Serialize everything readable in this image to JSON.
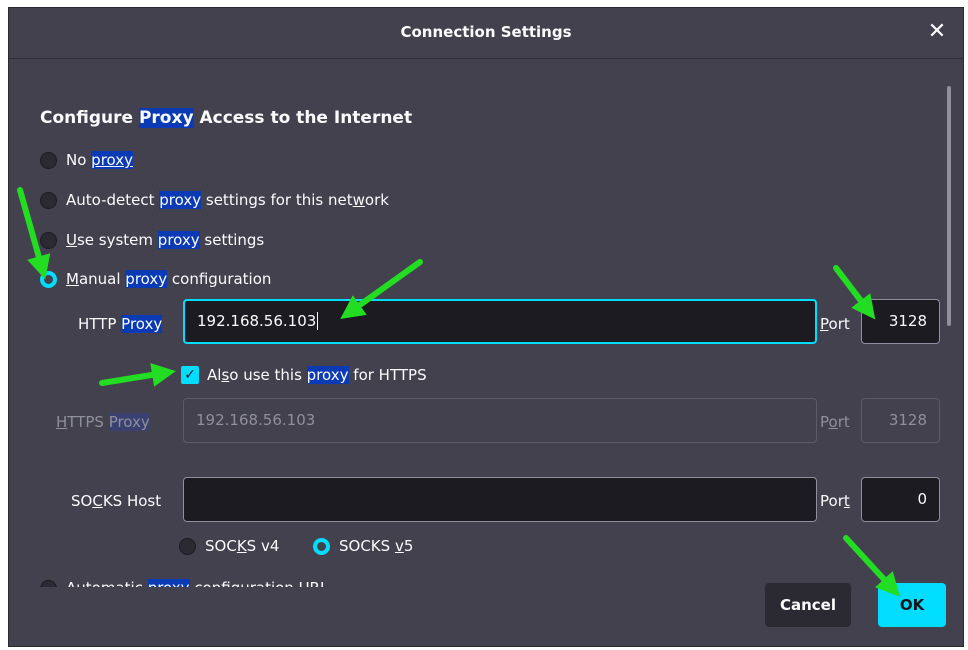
{
  "dialog": {
    "title": "Connection Settings",
    "close_icon": "✕"
  },
  "section": {
    "heading_pre": "Configure ",
    "heading_hl": "Proxy",
    "heading_post": " Access to the Internet"
  },
  "options": {
    "no_proxy": {
      "pre": "No ",
      "hl": "proxy"
    },
    "auto_detect": {
      "pre": "Auto-detect ",
      "hl": "proxy",
      "post_a": " settings for this net",
      "u": "w",
      "post_b": "ork"
    },
    "system": {
      "u": "U",
      "pre": "se system ",
      "hl": "proxy",
      "post": " settings"
    },
    "manual": {
      "u": "M",
      "pre": "anual ",
      "hl": "proxy",
      "post": " configuration",
      "selected": true
    },
    "auto_url": {
      "pre": "Automatic ",
      "hl": "proxy",
      "post": " configuration URL"
    }
  },
  "http": {
    "label_pre": "HTTP ",
    "label_hl": "Proxy",
    "value": "192.168.56.103",
    "port_label": "Port",
    "port_u": "P",
    "port_value": "3128"
  },
  "also_https": {
    "pre": "Al",
    "u": "s",
    "mid": "o use this ",
    "hl": "proxy",
    "post": " for HTTPS",
    "checked": true
  },
  "https": {
    "label_u": "H",
    "label_pre": "TTPS ",
    "label_hl": "Proxy",
    "value": "192.168.56.103",
    "port_pre": "P",
    "port_u": "o",
    "port_post": "rt",
    "port_value": "3128"
  },
  "socks": {
    "label_pre": "SO",
    "label_u": "C",
    "label_post": "KS Host",
    "value": "",
    "port_pre": "Por",
    "port_u": "t",
    "port_value": "0",
    "v4_pre": "SOC",
    "v4_u": "K",
    "v4_post": "S v4",
    "v5_pre": "SOCKS ",
    "v5_u": "v",
    "v5_post": "5",
    "v5_selected": true
  },
  "buttons": {
    "cancel": "Cancel",
    "ok": "OK"
  },
  "colors": {
    "dialog_bg": "#42414d",
    "accent": "#00ddff",
    "highlight": "#0a3ab4",
    "annotation_arrow": "#22dd22"
  }
}
